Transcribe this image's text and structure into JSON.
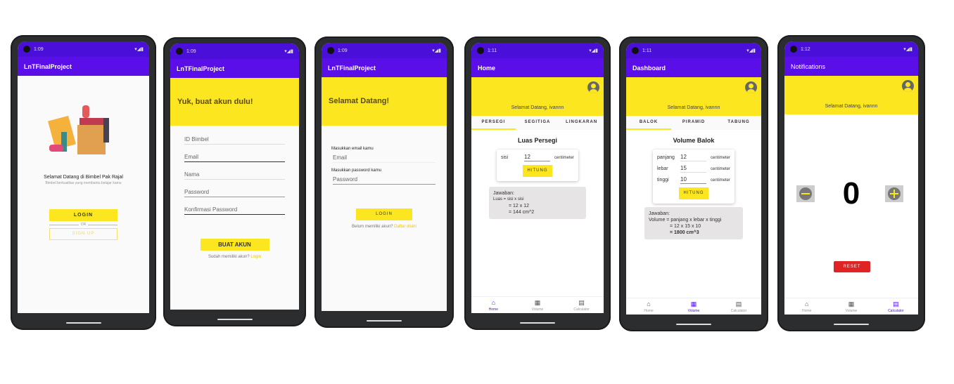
{
  "status": {
    "time1": "1:09",
    "time2": "1:09",
    "time3": "1:09",
    "time4": "1:11",
    "time5": "1:11",
    "time6": "1:12",
    "icons": "▾◢▮"
  },
  "app_title": "LnTFinalProject",
  "welcome_screen": {
    "title": "Selamat Datang di Bimbel Pak Rajal",
    "subtitle": "Bimbel berkualitas yang membantu belajar kamu",
    "login": "LOGIN",
    "or": "OR",
    "signup": "SIGN UP"
  },
  "register_screen": {
    "header": "Yuk, buat akun dulu!",
    "fields": [
      "ID Bimbel",
      "Email",
      "Nama",
      "Password",
      "Konfirmasi Password"
    ],
    "button": "BUAT AKUN",
    "link_text": "Sudah memiliki akun?",
    "link": "Login"
  },
  "login_screen": {
    "header": "Selamat Datang!",
    "email_label": "Masukkan email kamu",
    "email_placeholder": "Email",
    "password_label": "Masukkan password kamu",
    "password_placeholder": "Password",
    "button": "LOGIN",
    "link_text": "Belum memiliki akun?",
    "link": "Daftar disini"
  },
  "welcome_user": "Selamat Datang, ivannn",
  "home_screen": {
    "title": "Home",
    "tabs": [
      "PERSEGI",
      "SEGITIGA",
      "LINGKARAN"
    ],
    "card_title": "Luas Persegi",
    "input_label": "sisi",
    "input_value": "12",
    "unit": "centimeter",
    "button": "HITUNG",
    "answer": [
      "Jawaban:",
      "Luas = sisi x sisi",
      "= 12 x 12",
      "= 144 cm^2"
    ]
  },
  "dashboard_screen": {
    "title": "Dashboard",
    "tabs": [
      "BALOK",
      "PIRAMID",
      "TABUNG"
    ],
    "card_title": "Volume Balok",
    "inputs": [
      {
        "label": "panjang",
        "value": "12",
        "unit": "centimeter"
      },
      {
        "label": "lebar",
        "value": "15",
        "unit": "centimeter"
      },
      {
        "label": "tinggi",
        "value": "10",
        "unit": "centimeter"
      }
    ],
    "button": "HITUNG",
    "answer": [
      "Jawaban:",
      "Volume = panjang x lebar x tinggi",
      "= 12 x 15 x 10",
      "= 1800 cm^3"
    ]
  },
  "notifications_screen": {
    "title": "Notifications",
    "counter": "0",
    "reset": "RESET"
  },
  "bottom_nav": [
    "Home",
    "Volume",
    "Calculator"
  ],
  "colors": {
    "primary": "#5a0ee8",
    "accent": "#fbe61f",
    "reset": "#e02424"
  }
}
